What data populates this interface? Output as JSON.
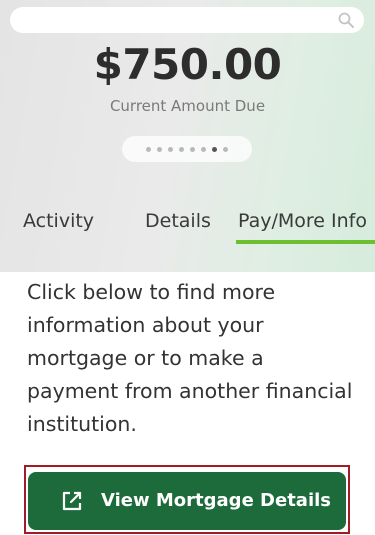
{
  "search": {
    "icon": "search-icon",
    "placeholder": ""
  },
  "summary": {
    "amount": "$750.00",
    "label": "Current Amount Due",
    "pager": {
      "total": 8,
      "active_index": 6
    }
  },
  "tabs": [
    {
      "label": "Activity"
    },
    {
      "label": "Details"
    },
    {
      "label": "Pay/More Info",
      "selected": true
    }
  ],
  "content": {
    "description": "Click below to find more information about your mortgage or to make a payment from another financial institution."
  },
  "action": {
    "label": "View Mortgage Details",
    "icon": "external-link-icon"
  },
  "colors": {
    "accent_green": "#6cbf2f",
    "button_green": "#1d6b3a",
    "highlight_red": "#a01d26"
  }
}
